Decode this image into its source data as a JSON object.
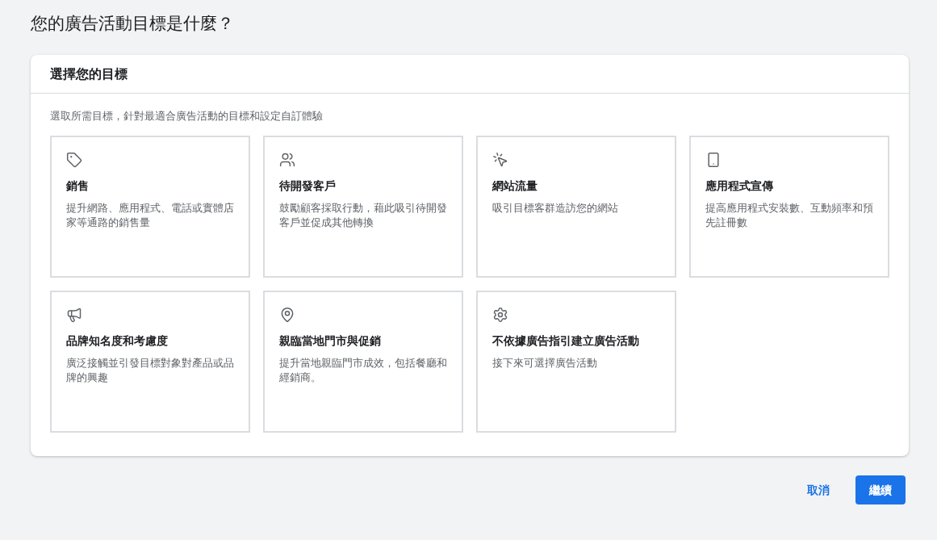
{
  "page_title": "您的廣告活動目標是什麼？",
  "panel": {
    "title": "選擇您的目標",
    "subtitle": "選取所需目標，針對最適合廣告活動的目標和設定自訂體驗",
    "goals": [
      {
        "kind": "sales",
        "title": "銷售",
        "description": "提升網路、應用程式、電話或實體店家等通路的銷售量",
        "selected": false
      },
      {
        "kind": "leads",
        "title": "待開發客戶",
        "description": "鼓勵顧客採取行動，藉此吸引待開發客戶並促成其他轉換",
        "selected": false
      },
      {
        "kind": "traffic",
        "title": "網站流量",
        "description": "吸引目標客群造訪您的網站",
        "selected": false
      },
      {
        "kind": "app",
        "title": "應用程式宣傳",
        "description": "提高應用程式安裝數、互動頻率和預先註冊數",
        "selected": false
      },
      {
        "kind": "awareness",
        "title": "品牌知名度和考慮度",
        "description": "廣泛接觸並引發目標對象對產品或品牌的興趣",
        "selected": false
      },
      {
        "kind": "local",
        "title": "親臨當地門市與促銷",
        "description": "提升當地親臨門市成效，包括餐廳和經銷商。",
        "selected": false
      },
      {
        "kind": "none",
        "title": "不依據廣告指引建立廣告活動",
        "description": "接下來可選擇廣告活動",
        "selected": false
      }
    ]
  },
  "buttons": {
    "cancel": "取消",
    "continue": "繼續"
  }
}
